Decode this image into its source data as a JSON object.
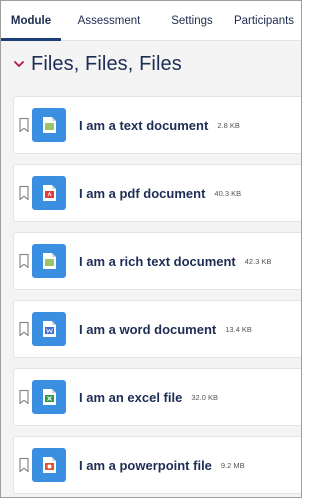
{
  "tabs": [
    {
      "label": "Module",
      "active": true
    },
    {
      "label": "Assessment",
      "active": false
    },
    {
      "label": "Settings",
      "active": false
    },
    {
      "label": "Participants",
      "active": false
    }
  ],
  "section": {
    "title": "Files, Files, Files",
    "expanded": true,
    "chevron_color": "#b5125a"
  },
  "files": [
    {
      "name": "I am a text document",
      "size": "2.8 KB",
      "icon": "text-file-icon",
      "badge_color": "#9bc46a"
    },
    {
      "name": "I am a pdf document",
      "size": "40.3 KB",
      "icon": "pdf-file-icon",
      "badge_color": "#e23b3b"
    },
    {
      "name": "I am a rich text document",
      "size": "42.3 KB",
      "icon": "rich-text-file-icon",
      "badge_color": "#9bc46a"
    },
    {
      "name": "I am a word document",
      "size": "13.4 KB",
      "icon": "word-file-icon",
      "badge_color": "#3b6fd6"
    },
    {
      "name": "I am an excel file",
      "size": "32.0 KB",
      "icon": "excel-file-icon",
      "badge_color": "#2e9a4c"
    },
    {
      "name": "I am a powerpoint file",
      "size": "9.2 MB",
      "icon": "powerpoint-file-icon",
      "badge_color": "#e0522a"
    }
  ],
  "colors": {
    "accent": "#1c3f7a",
    "file_tile": "#3a8fe0",
    "text_primary": "#1e2d55"
  }
}
